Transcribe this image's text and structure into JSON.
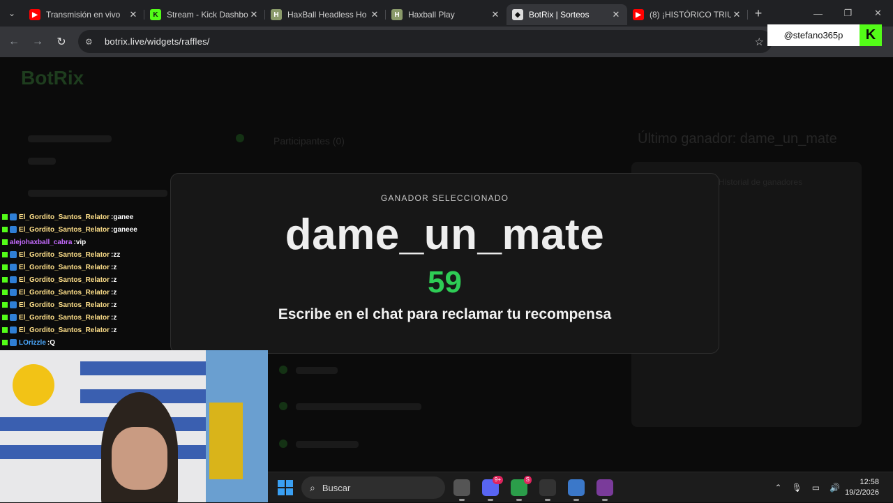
{
  "browser": {
    "tabs": [
      {
        "title": "Transmisión en vivo",
        "favicon": "youtube-icon",
        "color": "#ff0000",
        "glyph": "▶"
      },
      {
        "title": "Stream - Kick Dashbo",
        "favicon": "kick-icon",
        "color": "#53fc18",
        "glyph": "K"
      },
      {
        "title": "HaxBall Headless Ho",
        "favicon": "haxball-icon",
        "color": "#8a9a6a",
        "glyph": "H"
      },
      {
        "title": "Haxball Play",
        "favicon": "haxball-icon",
        "color": "#8a9a6a",
        "glyph": "H"
      },
      {
        "title": "BotRix | Sorteos",
        "favicon": "botrix-icon",
        "color": "#dddddd",
        "glyph": "◆"
      },
      {
        "title": "(8) ¡HISTÓRICO TRIU",
        "favicon": "youtube-icon",
        "color": "#ff0000",
        "glyph": "▶"
      }
    ],
    "url": "botrix.live/widgets/raffles/"
  },
  "overlay": {
    "kick_user": "@stefano365p",
    "kick_logo": "K"
  },
  "page": {
    "ghost_logo": "BotRix",
    "ghost_texts": [
      "Participantes (0)",
      "Último ganador: dame_un_mate",
      "Historial de ganadores"
    ],
    "raffle": {
      "label": "GANADOR SELECCIONADO",
      "winner": "dame_un_mate",
      "countdown": "59",
      "message": "Escribe en el chat para reclamar tu recompensa"
    }
  },
  "chat": [
    {
      "user": "El_Gordito_Santos_Relator",
      "msg": "ganee",
      "color": "#ffe08a",
      "sub": true
    },
    {
      "user": "El_Gordito_Santos_Relator",
      "msg": "ganeee",
      "color": "#ffe08a",
      "sub": true
    },
    {
      "user": "alejohaxball_cabra",
      "msg": "vip",
      "color": "#c56bff",
      "sub": false
    },
    {
      "user": "El_Gordito_Santos_Relator",
      "msg": "zz",
      "color": "#ffe08a",
      "sub": true
    },
    {
      "user": "El_Gordito_Santos_Relator",
      "msg": "z",
      "color": "#ffe08a",
      "sub": true
    },
    {
      "user": "El_Gordito_Santos_Relator",
      "msg": "z",
      "color": "#ffe08a",
      "sub": true
    },
    {
      "user": "El_Gordito_Santos_Relator",
      "msg": "z",
      "color": "#ffe08a",
      "sub": true
    },
    {
      "user": "El_Gordito_Santos_Relator",
      "msg": "z",
      "color": "#ffe08a",
      "sub": true
    },
    {
      "user": "El_Gordito_Santos_Relator",
      "msg": "z",
      "color": "#ffe08a",
      "sub": true
    },
    {
      "user": "El_Gordito_Santos_Relator",
      "msg": "z",
      "color": "#ffe08a",
      "sub": true
    },
    {
      "user": "LOrizzle",
      "msg": "Q",
      "color": "#4aa8ff",
      "sub": true
    }
  ],
  "taskbar": {
    "search_placeholder": "Buscar",
    "time": "12:58",
    "date": "19/2/2026",
    "apps": [
      {
        "name": "file-explorer-icon",
        "color": "#555555"
      },
      {
        "name": "discord-icon",
        "color": "#5865f2",
        "badge": "9+"
      },
      {
        "name": "chrome-icon",
        "color": "#2b9d4a",
        "badge": "S"
      },
      {
        "name": "obs-icon",
        "color": "#333333"
      },
      {
        "name": "notepad-icon",
        "color": "#3b78c9"
      },
      {
        "name": "game-icon",
        "color": "#7a3b9a"
      }
    ]
  }
}
